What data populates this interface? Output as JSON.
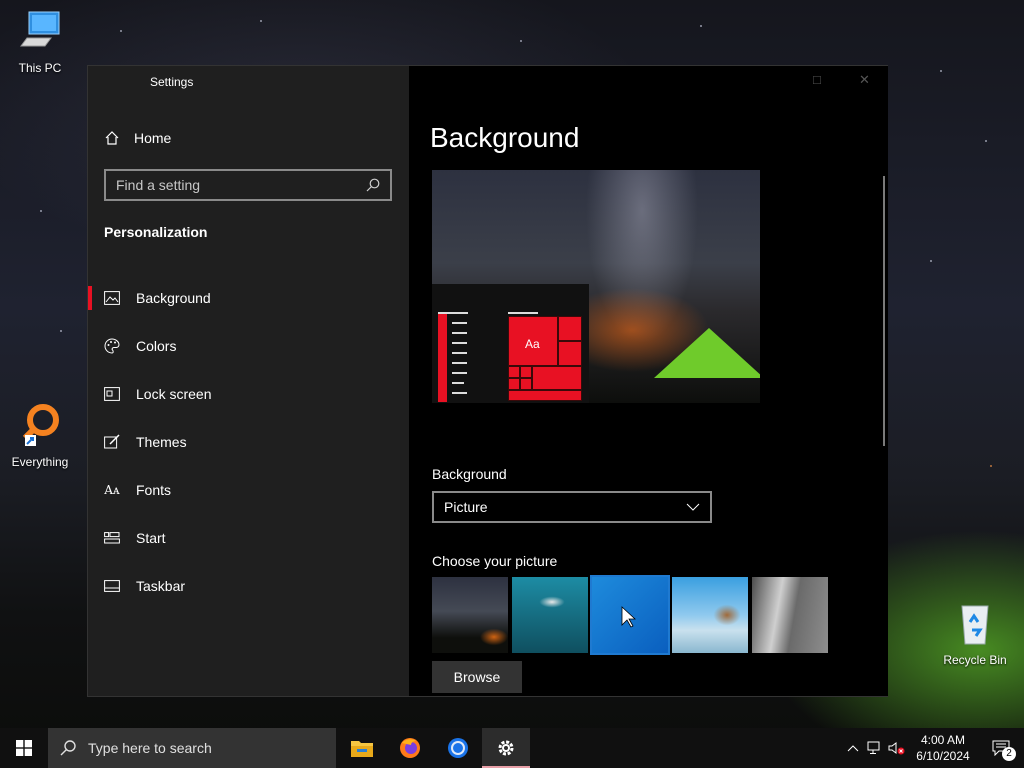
{
  "desktop": {
    "icons": [
      {
        "label": "This PC"
      },
      {
        "label": "Everything"
      },
      {
        "label": "Recycle Bin"
      }
    ]
  },
  "window": {
    "title": "Settings",
    "sidebar": {
      "home_label": "Home",
      "search_placeholder": "Find a setting",
      "section_title": "Personalization",
      "items": [
        {
          "label": "Background",
          "icon": "picture-icon",
          "active": true
        },
        {
          "label": "Colors",
          "icon": "palette-icon"
        },
        {
          "label": "Lock screen",
          "icon": "lock-screen-icon"
        },
        {
          "label": "Themes",
          "icon": "themes-brush-icon"
        },
        {
          "label": "Fonts",
          "icon": "fonts-icon"
        },
        {
          "label": "Start",
          "icon": "start-grid-icon"
        },
        {
          "label": "Taskbar",
          "icon": "taskbar-icon"
        }
      ]
    },
    "content": {
      "heading": "Background",
      "preview_sample_text": "Aa",
      "background_label": "Background",
      "background_value": "Picture",
      "choose_picture_label": "Choose your picture",
      "browse_label": "Browse",
      "accent_color": "#e81123"
    }
  },
  "taskbar": {
    "search_placeholder": "Type here to search",
    "apps": [
      "file-explorer-icon",
      "firefox-icon",
      "chrome-icon",
      "settings-gear-icon"
    ],
    "clock_time": "4:00 AM",
    "clock_date": "6/10/2024",
    "notification_count": "2"
  }
}
